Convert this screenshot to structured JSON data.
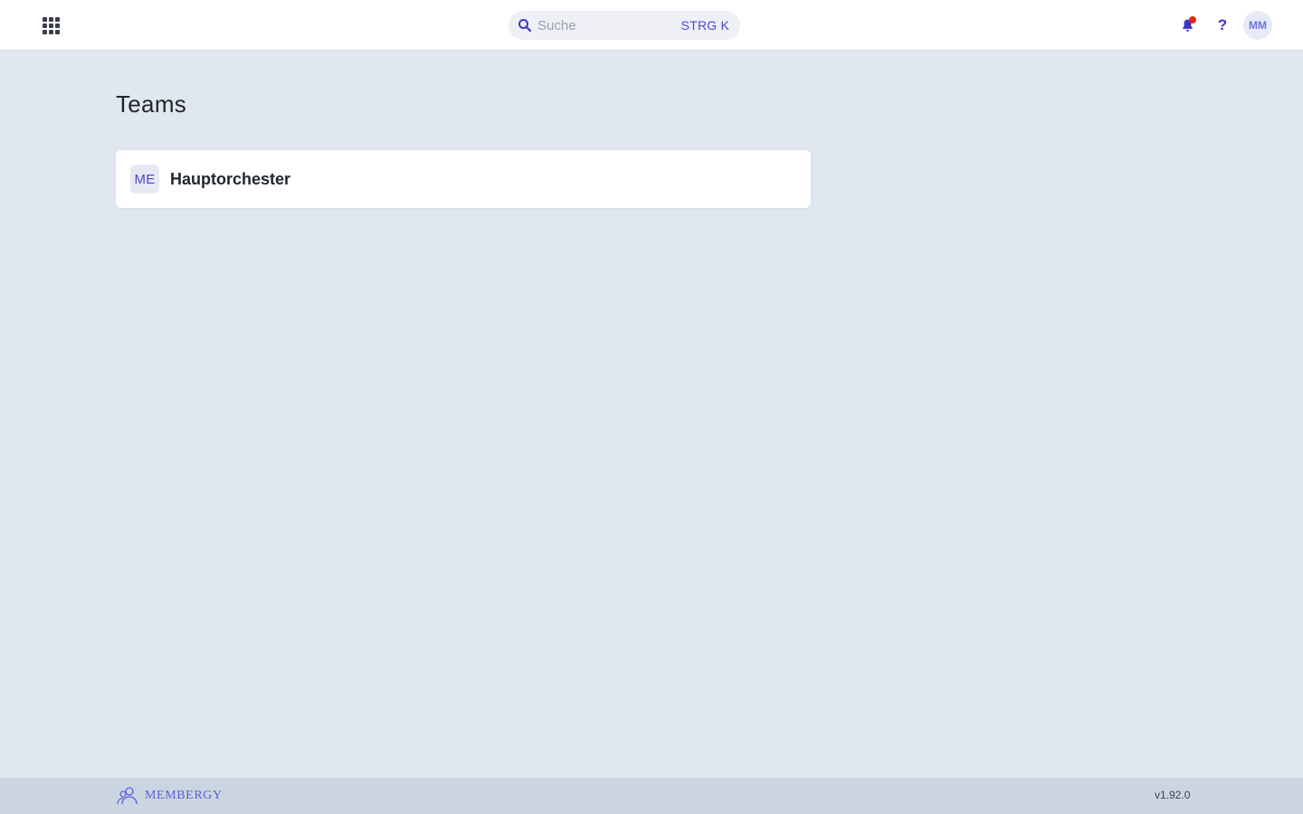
{
  "header": {
    "apps_icon": "apps-grid-icon",
    "search": {
      "placeholder": "Suche",
      "shortcut": "STRG K",
      "icon": "search-icon"
    },
    "notifications": {
      "icon": "bell-icon",
      "has_unread": true,
      "indicator_color": "#e1261c"
    },
    "help_label": "?",
    "avatar_initials": "MM"
  },
  "main": {
    "title": "Teams",
    "teams": [
      {
        "initials": "ME",
        "name": "Hauptorchester"
      }
    ]
  },
  "footer": {
    "brand": "MEMBERGY",
    "version": "v1.92.0"
  },
  "colors": {
    "accent": "#4a47d6",
    "background": "#e1e7ef",
    "footer_background": "#cbd5e1"
  }
}
